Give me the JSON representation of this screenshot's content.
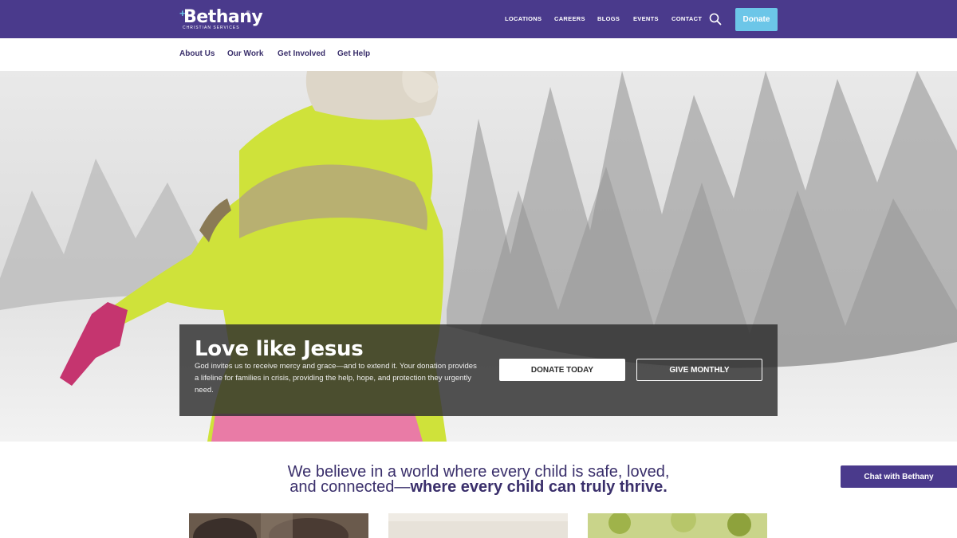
{
  "brand": {
    "name": "Bethany",
    "subtitle": "CHRISTIAN SERVICES",
    "plus_glyph": "+",
    "tm": "®"
  },
  "utility_nav": {
    "links": [
      "LOCATIONS",
      "CAREERS",
      "BLOGS",
      "EVENTS",
      "CONTACT"
    ],
    "donate_label": "Donate"
  },
  "main_nav": {
    "items": [
      "About Us",
      "Our Work",
      "Get Involved",
      "Get Help"
    ]
  },
  "hero": {
    "title": "Love like Jesus",
    "body": "God invites us to receive mercy and grace—and to extend it. Your donation provides a lifeline for families in crisis, providing the help, hope, and protection they urgently need.",
    "cta_primary": "DONATE TODAY",
    "cta_secondary": "GIVE MONTHLY"
  },
  "belief": {
    "line_a": "We believe in a world where every child is safe, loved,",
    "line_b_plain": "and connected—",
    "line_b_strong": "where every child can truly thrive."
  },
  "chat": {
    "label": "Chat with Bethany"
  },
  "colors": {
    "primary_purple": "#4a3a8c",
    "accent_blue": "#6cc6e8",
    "overlay": "#2d2d2d"
  },
  "icons": {
    "search": "search-icon"
  }
}
